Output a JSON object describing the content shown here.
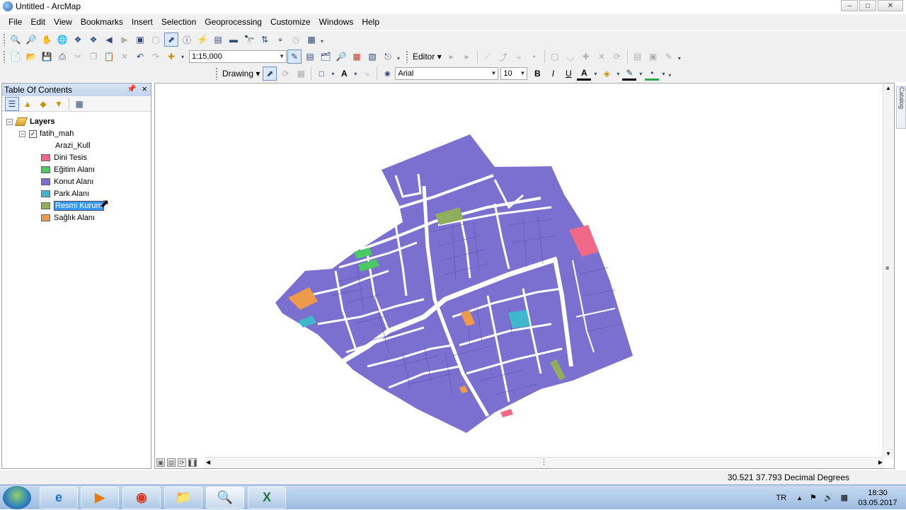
{
  "window": {
    "title": "Untitled - ArcMap"
  },
  "menu": [
    "File",
    "Edit",
    "View",
    "Bookmarks",
    "Insert",
    "Selection",
    "Geoprocessing",
    "Customize",
    "Windows",
    "Help"
  ],
  "toolbar": {
    "scale_value": "1:15,000",
    "editor_label": "Editor",
    "drawing_label": "Drawing",
    "font_name": "Arial",
    "font_size": "10",
    "bold_label": "B",
    "italic_label": "I",
    "underline_label": "U",
    "font_color_label": "A",
    "text_tool_label": "A"
  },
  "toc": {
    "title": "Table Of Contents",
    "root": "Layers",
    "layer_name": "fatih_mah",
    "field_name": "Arazi_Kull",
    "classes": [
      {
        "label": "Dini Tesis",
        "color": "#f06a88"
      },
      {
        "label": "Eğitim Alanı",
        "color": "#4cc864"
      },
      {
        "label": "Konut Alanı",
        "color": "#7b6fd0"
      },
      {
        "label": "Park Alanı",
        "color": "#3fb8cc"
      },
      {
        "label": "Resmi Kurum",
        "color": "#8faf5f"
      },
      {
        "label": "Sağlık Alanı",
        "color": "#ee9a4a"
      }
    ],
    "selected_index": 4
  },
  "status": {
    "coordinates": "30.521  37.793 Decimal Degrees"
  },
  "taskbar": {
    "language": "TR",
    "time": "18:30",
    "date": "03.05.2017"
  },
  "side_tab": {
    "label": "Catalog"
  },
  "colors": {
    "konut": "#7b6fd0",
    "street": "#ffffff",
    "parcel_line": "#5a4fb0"
  }
}
